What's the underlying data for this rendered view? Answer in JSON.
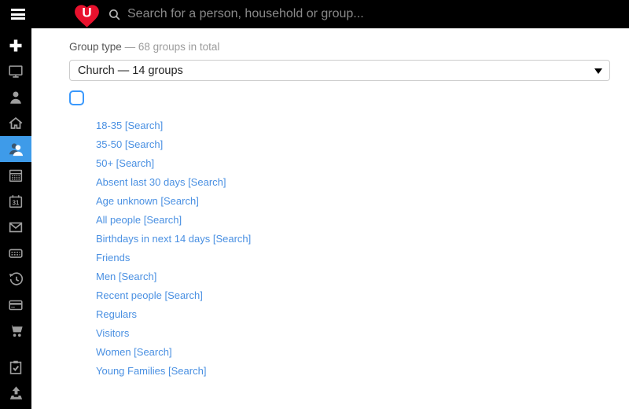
{
  "topbar": {
    "logo_letter": "U",
    "logo_heart_color": "#e8112d",
    "search": {
      "placeholder": "Search for a person, household or group..."
    }
  },
  "sidebar": {
    "selected_bg_color": "#3e9be9",
    "icon_color": "#9e9e9e",
    "items": [
      {
        "icon": "plus-icon",
        "selected": false
      },
      {
        "icon": "monitor-icon",
        "selected": false
      },
      {
        "icon": "person-icon",
        "selected": false
      },
      {
        "icon": "home-icon",
        "selected": false
      },
      {
        "icon": "people-group-icon",
        "selected": true
      },
      {
        "icon": "calendar-grid-icon",
        "selected": false
      },
      {
        "icon": "calendar-31-icon",
        "selected": false
      },
      {
        "icon": "envelope-icon",
        "selected": false
      },
      {
        "icon": "keyboard-icon",
        "selected": false
      },
      {
        "icon": "history-clock-icon",
        "selected": false
      },
      {
        "icon": "credit-card-icon",
        "selected": false
      },
      {
        "icon": "shopping-cart-icon",
        "selected": false
      },
      {
        "icon": "clipboard-check-icon",
        "selected": false
      },
      {
        "icon": "upload-tray-icon",
        "selected": false
      }
    ]
  },
  "main": {
    "group_type_label": "Group type",
    "group_type_summary": "— 68 groups in total",
    "group_type_select_value": "Church — 14 groups",
    "select_all_checked": false,
    "link_color": "#4a90e2",
    "groups": [
      {
        "label": "18-35 [Search]"
      },
      {
        "label": "35-50 [Search]"
      },
      {
        "label": "50+ [Search]"
      },
      {
        "label": "Absent last 30 days [Search]"
      },
      {
        "label": "Age unknown [Search]"
      },
      {
        "label": "All people [Search]"
      },
      {
        "label": "Birthdays in next 14 days [Search]"
      },
      {
        "label": "Friends"
      },
      {
        "label": "Men [Search]"
      },
      {
        "label": "Recent people [Search]"
      },
      {
        "label": "Regulars"
      },
      {
        "label": "Visitors"
      },
      {
        "label": "Women [Search]"
      },
      {
        "label": "Young Families [Search]"
      }
    ]
  }
}
